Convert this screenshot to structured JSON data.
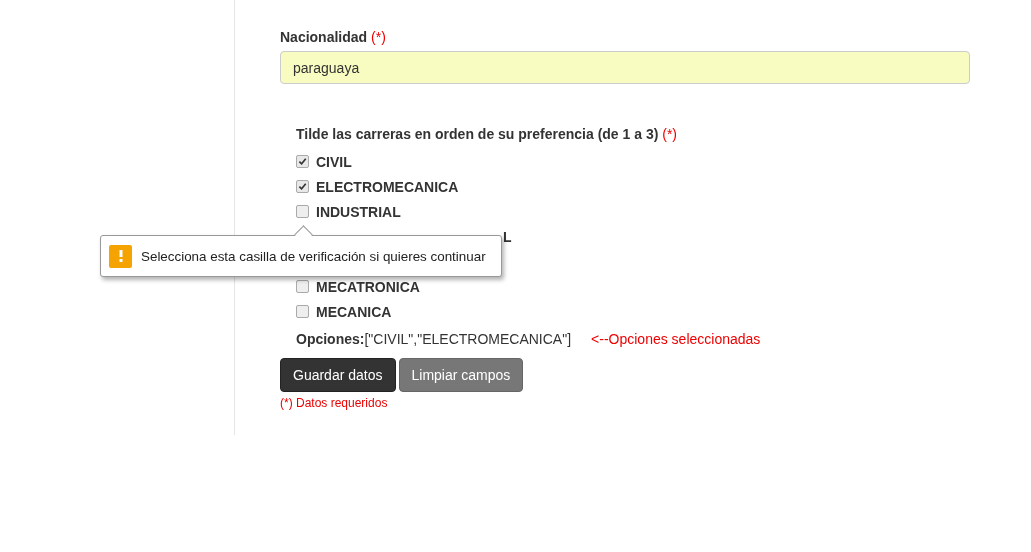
{
  "nationality": {
    "label": "Nacionalidad",
    "required_mark": "(*)",
    "value": "paraguaya"
  },
  "careers": {
    "title": "Tilde las carreras en orden de su preferencia (de 1 a 3)",
    "required_mark": "(*)",
    "items": [
      {
        "kind": "checkbox",
        "label": "CIVIL",
        "checked": true
      },
      {
        "kind": "checkbox",
        "label": "ELECTROMECANICA",
        "checked": true
      },
      {
        "kind": "checkbox",
        "label": "INDUSTRIAL",
        "checked": false
      },
      {
        "kind": "covered",
        "label": "L"
      },
      {
        "kind": "hidden"
      },
      {
        "kind": "checkbox",
        "label": "MECATRONICA",
        "checked": false
      },
      {
        "kind": "checkbox",
        "label": "MECANICA",
        "checked": false
      }
    ]
  },
  "tooltip": {
    "text": "Selecciona esta casilla de verificación si quieres continuar"
  },
  "options": {
    "label": "Opciones:",
    "value": "[\"CIVIL\",\"ELECTROMECANICA\"]",
    "note": "<--Opciones seleccionadas"
  },
  "buttons": [
    {
      "kind": "primary",
      "label": "Guardar datos"
    },
    {
      "kind": "secondary",
      "label": "Limpiar campos"
    }
  ],
  "footnote": "(*) Datos requeridos"
}
